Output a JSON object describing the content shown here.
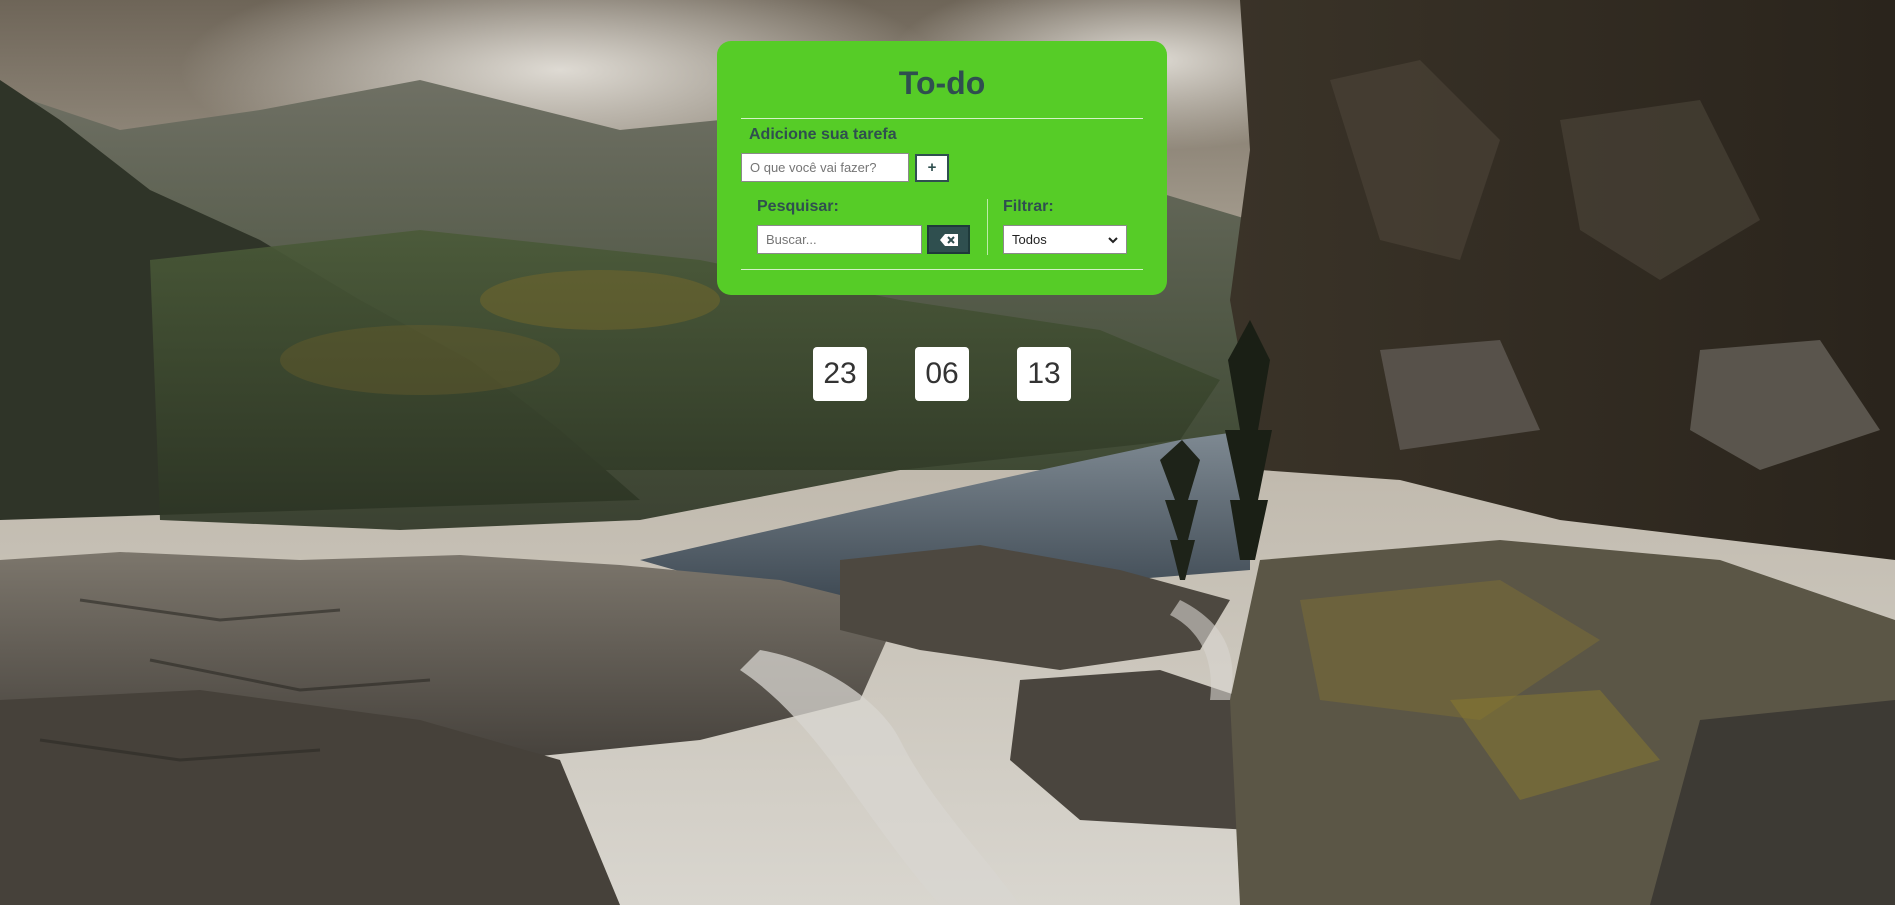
{
  "app": {
    "title": "To-do"
  },
  "add_task": {
    "label": "Adicione sua tarefa",
    "placeholder": "O que você vai fazer?",
    "value": "",
    "button_label": "+"
  },
  "search": {
    "label": "Pesquisar:",
    "placeholder": "Buscar...",
    "value": "",
    "clear_icon": "backspace-icon"
  },
  "filter": {
    "label": "Filtrar:",
    "selected": "Todos",
    "chevron_icon": "chevron-down-icon"
  },
  "clock": {
    "hours": "23",
    "minutes": "06",
    "seconds": "13"
  },
  "colors": {
    "card_bg": "#56cc27",
    "heading_text": "#2f4f4f",
    "clock_bg": "#ffffff"
  },
  "background": {
    "scene": "mountain-lake-landscape"
  }
}
